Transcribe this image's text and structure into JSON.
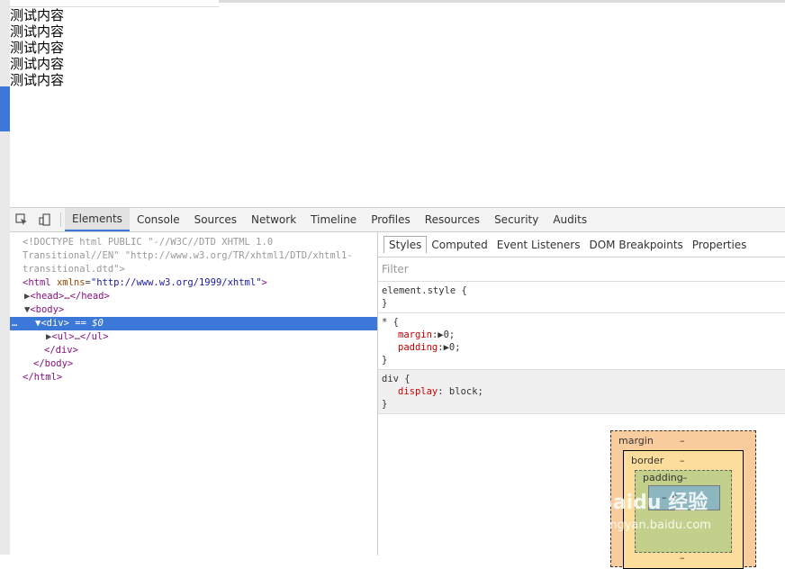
{
  "page": {
    "lines": [
      "测试内容",
      "测试内容",
      "测试内容",
      "测试内容",
      "测试内容"
    ]
  },
  "toolbar": {
    "tabs": [
      "Elements",
      "Console",
      "Sources",
      "Network",
      "Timeline",
      "Profiles",
      "Resources",
      "Security",
      "Audits"
    ]
  },
  "elements": {
    "doctype1": "<!DOCTYPE html PUBLIC \"-//W3C//DTD XHTML 1.0",
    "doctype2": "Transitional//EN\" \"http://www.w3.org/TR/xhtml1/DTD/xhtml1-",
    "doctype3": "transitional.dtd\">",
    "html_open": "<html",
    "html_attr": "xmlns",
    "html_val": "\"http://www.w3.org/1999/xhtml\"",
    "html_close": ">",
    "head": "<head>…</head>",
    "body_open": "<body>",
    "div_open": "<div>",
    "div_marker": "== $0",
    "ul": "<ul>…</ul>",
    "div_close": "</div>",
    "body_close": "</body>",
    "html_end": "</html>",
    "dots": "…"
  },
  "styles": {
    "subtabs": [
      "Styles",
      "Computed",
      "Event Listeners",
      "DOM Breakpoints",
      "Properties"
    ],
    "filter": "Filter",
    "rule1_selector": "element.style {",
    "rule1_close": "}",
    "rule2_selector": "* {",
    "rule2_p1_name": "margin",
    "rule2_p1_val": "0;",
    "rule2_p2_name": "padding",
    "rule2_p2_val": "0;",
    "rule2_close": "}",
    "rule3_selector": "div {",
    "rule3_p1_name": "display",
    "rule3_p1_val": "block;",
    "rule3_close": "}"
  },
  "boxmodel": {
    "margin_label": "margin",
    "margin_value": "–",
    "border_label": "border",
    "border_value": "–",
    "padding_label": "padding",
    "padding_value": "–",
    "content_value": "– × –",
    "bottom_value": "–"
  },
  "watermark": {
    "brand": "Baidu 经验",
    "url": "jingyan.baidu.com"
  }
}
